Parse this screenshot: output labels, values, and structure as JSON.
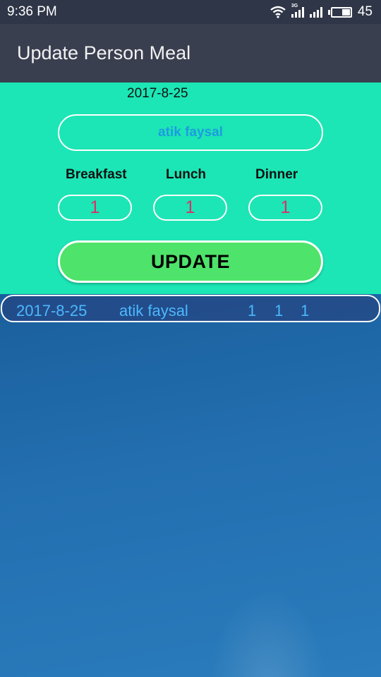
{
  "status_bar": {
    "time": "9:36 PM",
    "network_type": "3G",
    "battery_level": "45",
    "icons": [
      "wifi-icon",
      "signal-icon",
      "signal-icon",
      "battery-icon"
    ]
  },
  "app_bar": {
    "title": "Update Person Meal"
  },
  "form": {
    "date": "2017-8-25",
    "person_name": "atik faysal",
    "meals": [
      {
        "label": "Breakfast",
        "count": "1"
      },
      {
        "label": "Lunch",
        "count": "1"
      },
      {
        "label": "Dinner",
        "count": "1"
      }
    ],
    "update_label": "UPDATE"
  },
  "list": {
    "rows": [
      {
        "date": "2017-8-25",
        "name": "atik faysal",
        "breakfast": "1",
        "lunch": "1",
        "dinner": "1"
      }
    ]
  },
  "colors": {
    "form_background": "#1ce6b5",
    "app_bar": "#3a3f50",
    "update_button": "#4ee36a",
    "name_text": "#1e9be0",
    "count_text": "#d6326a",
    "list_text": "#4cb8ff"
  }
}
